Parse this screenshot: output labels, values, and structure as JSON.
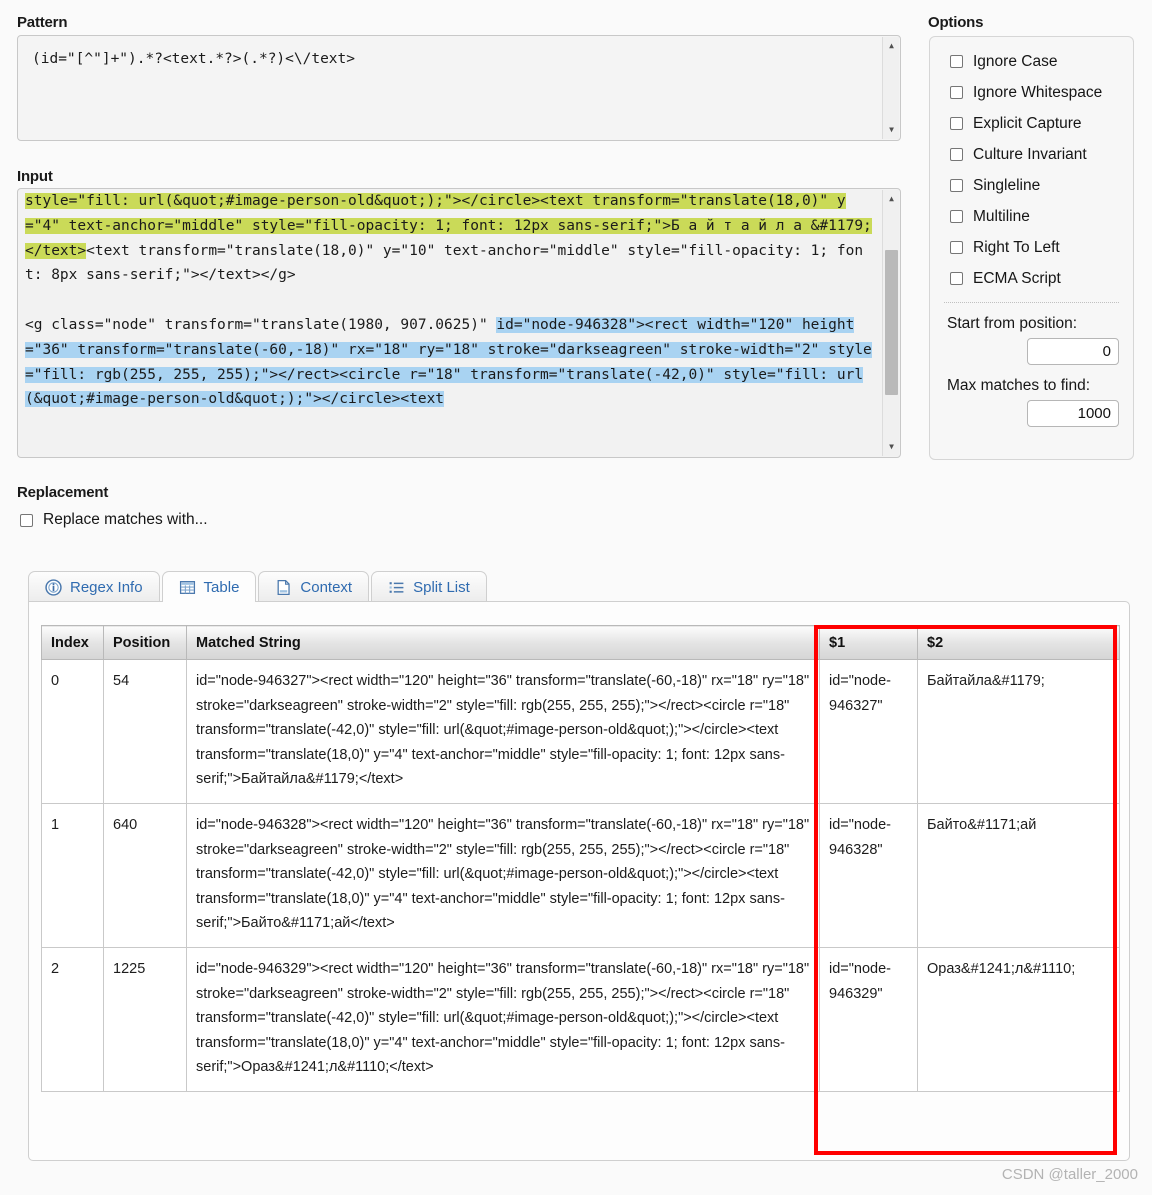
{
  "pattern": {
    "label": "Pattern",
    "value": "(id=\"[^\"]+\").*?<text.*?>(.*?)<\\/text>"
  },
  "input": {
    "label": "Input",
    "segments": [
      {
        "style": "green",
        "text": "style=\"fill: url(&quot;#image-person-old&quot;);\"></circle><text transform=\"translate(18,0)\" y=\"4\" text-anchor=\"middle\" style=\"fill-opacity: 1; font: 12px sans-serif;\">Б а й т а й л а &#1179;</text>"
      },
      {
        "style": "plain",
        "text": "<text transform=\"translate(18,0)\" y=\"10\" text-anchor=\"middle\" style=\"fill-opacity: 1; font: 8px sans-serif;\"></text></g>\n\n<g class=\"node\" transform=\"translate(1980, 907.0625)\" "
      },
      {
        "style": "blue",
        "text": "id=\"node-946328\"><rect width=\"120\" height=\"36\" transform=\"translate(-60,-18)\" rx=\"18\" ry=\"18\" stroke=\"darkseagreen\" stroke-width=\"2\" style=\"fill: rgb(255, 255, 255);\"></rect><circle r=\"18\" transform=\"translate(-42,0)\" style=\"fill: url(&quot;#image-person-old&quot;);\"></circle><text"
      }
    ]
  },
  "options": {
    "label": "Options",
    "checkboxes": [
      {
        "label": "Ignore Case",
        "checked": false
      },
      {
        "label": "Ignore Whitespace",
        "checked": false
      },
      {
        "label": "Explicit Capture",
        "checked": false
      },
      {
        "label": "Culture Invariant",
        "checked": false
      },
      {
        "label": "Singleline",
        "checked": false
      },
      {
        "label": "Multiline",
        "checked": false
      },
      {
        "label": "Right To Left",
        "checked": false
      },
      {
        "label": "ECMA Script",
        "checked": false
      }
    ],
    "start_position": {
      "label": "Start from position:",
      "value": "0"
    },
    "max_matches": {
      "label": "Max matches to find:",
      "value": "1000"
    }
  },
  "replacement": {
    "label": "Replacement",
    "checkbox_label": "Replace matches with...",
    "checked": false
  },
  "tabs": [
    {
      "label": "Regex Info",
      "icon": "info-icon",
      "active": false
    },
    {
      "label": "Table",
      "icon": "table-icon",
      "active": true
    },
    {
      "label": "Context",
      "icon": "document-icon",
      "active": false
    },
    {
      "label": "Split List",
      "icon": "list-icon",
      "active": false
    }
  ],
  "results_table": {
    "columns": [
      "Index",
      "Position",
      "Matched String",
      "$1",
      "$2"
    ],
    "rows": [
      {
        "index": "0",
        "position": "54",
        "matched": "id=\"node-946327\"><rect width=\"120\" height=\"36\" transform=\"translate(-60,-18)\" rx=\"18\" ry=\"18\" stroke=\"darkseagreen\" stroke-width=\"2\" style=\"fill: rgb(255, 255, 255);\"></rect><circle r=\"18\" transform=\"translate(-42,0)\" style=\"fill: url(&quot;#image-person-old&quot;);\"></circle><text transform=\"translate(18,0)\" y=\"4\" text-anchor=\"middle\" style=\"fill-opacity: 1; font: 12px sans-serif;\">Байтайла&#1179;</text>",
        "g1": "id=\"node-946327\"",
        "g2": "Байтайла&#1179;"
      },
      {
        "index": "1",
        "position": "640",
        "matched": "id=\"node-946328\"><rect width=\"120\" height=\"36\" transform=\"translate(-60,-18)\" rx=\"18\" ry=\"18\" stroke=\"darkseagreen\" stroke-width=\"2\" style=\"fill: rgb(255, 255, 255);\"></rect><circle r=\"18\" transform=\"translate(-42,0)\" style=\"fill: url(&quot;#image-person-old&quot;);\"></circle><text transform=\"translate(18,0)\" y=\"4\" text-anchor=\"middle\" style=\"fill-opacity: 1; font: 12px sans-serif;\">Байто&#1171;ай</text>",
        "g1": "id=\"node-946328\"",
        "g2": "Байто&#1171;ай"
      },
      {
        "index": "2",
        "position": "1225",
        "matched": "id=\"node-946329\"><rect width=\"120\" height=\"36\" transform=\"translate(-60,-18)\" rx=\"18\" ry=\"18\" stroke=\"darkseagreen\" stroke-width=\"2\" style=\"fill: rgb(255, 255, 255);\"></rect><circle r=\"18\" transform=\"translate(-42,0)\" style=\"fill: url(&quot;#image-person-old&quot;);\"></circle><text transform=\"translate(18,0)\" y=\"4\" text-anchor=\"middle\" style=\"fill-opacity: 1; font: 12px sans-serif;\">Ораз&#1241;л&#1110;</text>",
        "g1": "id=\"node-946329\"",
        "g2": "Ораз&#1241;л&#1110;"
      }
    ]
  },
  "annotation": {
    "color": "#ff0000"
  },
  "watermark": "CSDN @taller_2000"
}
